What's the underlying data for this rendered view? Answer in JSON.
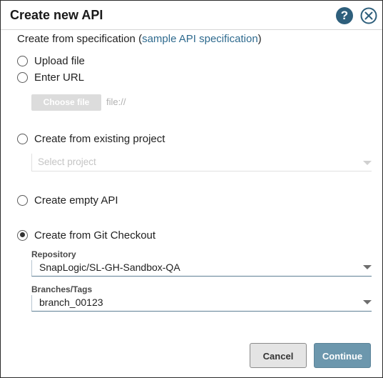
{
  "dialog": {
    "title": "Create new API",
    "help_icon": "help-icon",
    "close_icon": "close-icon"
  },
  "spec": {
    "prefix": "Create from specification",
    "open_paren": " (",
    "link": "sample API specification",
    "close_paren": ")"
  },
  "options": {
    "upload_file": "Upload file",
    "enter_url": "Enter URL",
    "existing_project": "Create from existing project",
    "empty_api": "Create empty API",
    "git_checkout": "Create from Git Checkout",
    "selected": "git_checkout"
  },
  "file": {
    "choose_label": "Choose file",
    "url_placeholder": "file://"
  },
  "project": {
    "placeholder": "Select project"
  },
  "repository": {
    "label": "Repository",
    "value": "SnapLogic/SL-GH-Sandbox-QA"
  },
  "branches": {
    "label": "Branches/Tags",
    "value": "branch_00123"
  },
  "buttons": {
    "cancel": "Cancel",
    "continue": "Continue"
  },
  "colors": {
    "accent": "#2e5f7c",
    "link": "#2e6a8e",
    "continue_bg": "#6c97ad"
  }
}
